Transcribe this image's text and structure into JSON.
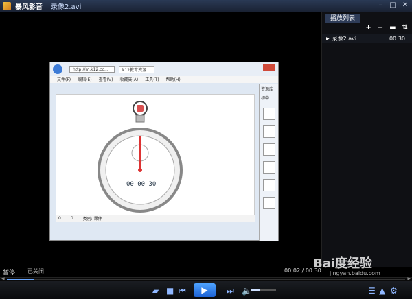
{
  "window": {
    "app_name": "暴风影音",
    "file_title": "录像2.avi"
  },
  "playlist": {
    "tab": "播放列表",
    "items": [
      {
        "name": "录像2.avi",
        "duration": "00:30"
      }
    ]
  },
  "status": {
    "state": "暂停",
    "closed": "已关闭",
    "time": "00:02 / 00:30"
  },
  "progress": {
    "fraction": 0.067
  },
  "volume": {
    "fraction": 0.35
  },
  "embedded": {
    "address": "http://m.k12.co...",
    "tab": "k12教育资源",
    "menu": [
      "文件(F)",
      "编辑(E)",
      "查看(V)",
      "收藏夹(A)",
      "工具(T)",
      "帮助(H)"
    ],
    "side_title": "资源库",
    "side_sub": "初中",
    "bottom_count_left": "0",
    "bottom_count_right": "0",
    "bottom_label": "类别: 课件",
    "stopwatch": "00 00 30"
  },
  "watermark": {
    "main": "Bai度经验",
    "sub": "jingyan.baidu.com"
  },
  "colors": {
    "accent": "#4ea3ff",
    "title_bg": "#2a3a55"
  }
}
